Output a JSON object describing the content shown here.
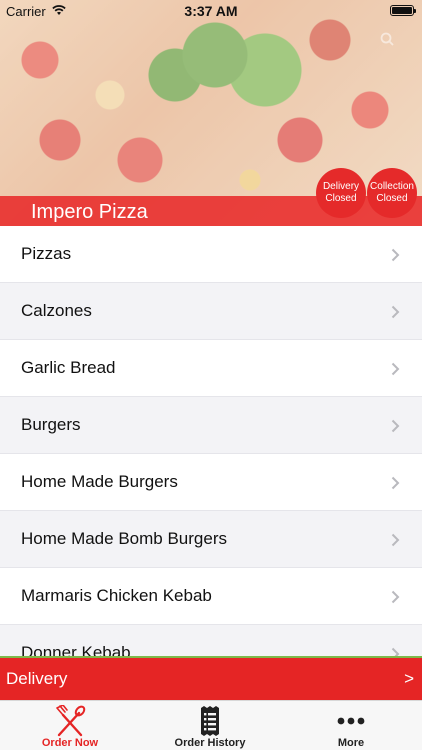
{
  "status_bar": {
    "carrier": "Carrier",
    "time": "3:37 AM"
  },
  "restaurant": {
    "name": "Impero Pizza"
  },
  "badges": {
    "delivery": {
      "line1": "Delivery",
      "line2": "Closed"
    },
    "collection": {
      "line1": "Collection",
      "line2": "Closed"
    }
  },
  "menu": {
    "categories": [
      "Pizzas",
      "Calzones",
      "Garlic Bread",
      "Burgers",
      "Home Made Burgers",
      "Home Made Bomb Burgers",
      "Marmaris Chicken Kebab",
      "Donner Kebab"
    ]
  },
  "order_type_bar": {
    "label": "Delivery",
    "arrow": ">"
  },
  "tabs": [
    {
      "label": "Order Now",
      "icon": "fork-knife-icon"
    },
    {
      "label": "Order History",
      "icon": "receipt-icon"
    },
    {
      "label": "More",
      "icon": "ellipsis-icon"
    }
  ],
  "colors": {
    "accent": "#e52525",
    "divider_green": "#7db84a"
  }
}
